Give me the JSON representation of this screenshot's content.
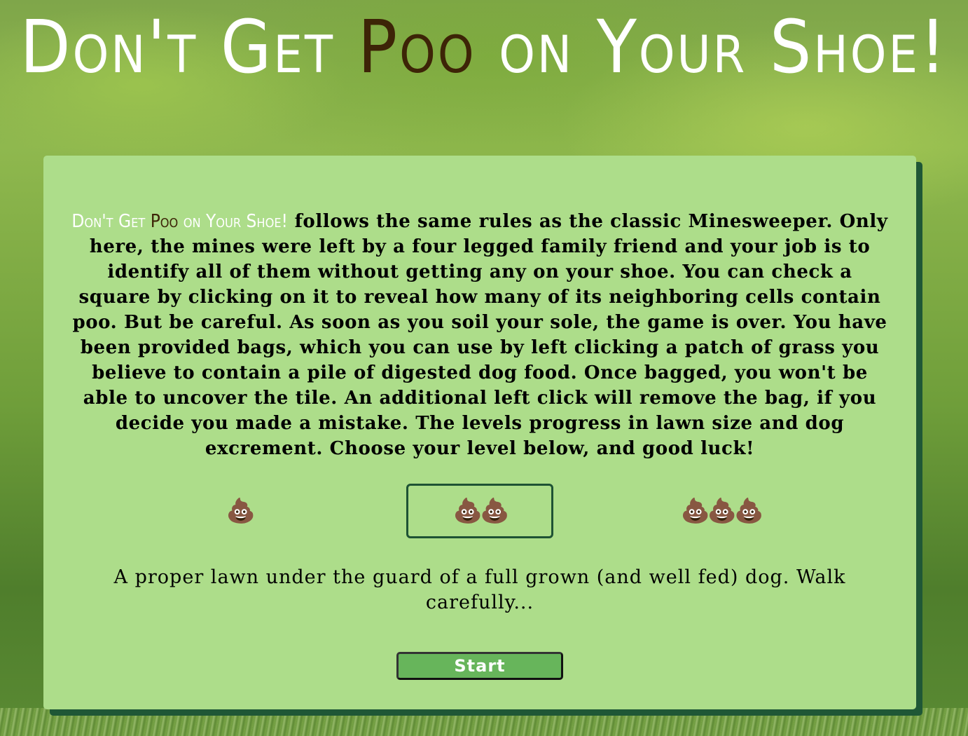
{
  "header": {
    "title_before": "Don't Get ",
    "title_poo": "Poo",
    "title_after": " on Your Shoe!"
  },
  "intro": {
    "inline_title_before": "Don't Get ",
    "inline_title_poo": "Poo",
    "inline_title_after": " on Your Shoe!",
    "text": " follows the same rules as the classic Minesweeper. Only here, the mines were left by a four legged family friend and your job is to identify all of them without getting any on your shoe. You can check a square by clicking on it to reveal how many of its neighboring cells contain poo. But be careful. As soon as you soil your sole, the game is over. You have been provided bags, which you can use by left clicking a patch of grass you believe to contain a pile of digested dog food. Once bagged, you won't be able to uncover the tile. An additional left click will remove the bag, if you decide you made a mistake. The levels progress in lawn size and dog excrement. Choose your level below, and good luck!"
  },
  "levels": [
    {
      "icons": "💩",
      "selected": false
    },
    {
      "icons": "💩💩",
      "selected": true
    },
    {
      "icons": "💩💩💩",
      "selected": false
    }
  ],
  "description": "A proper lawn under the guard of a full grown (and well fed) dog. Walk carefully...",
  "start_label": "Start",
  "colors": {
    "panel": "#addd8a",
    "panel_shadow": "#1f5736",
    "poo_text": "#3d2407",
    "start_button": "#67b55b",
    "selected_border": "#1e5234"
  }
}
